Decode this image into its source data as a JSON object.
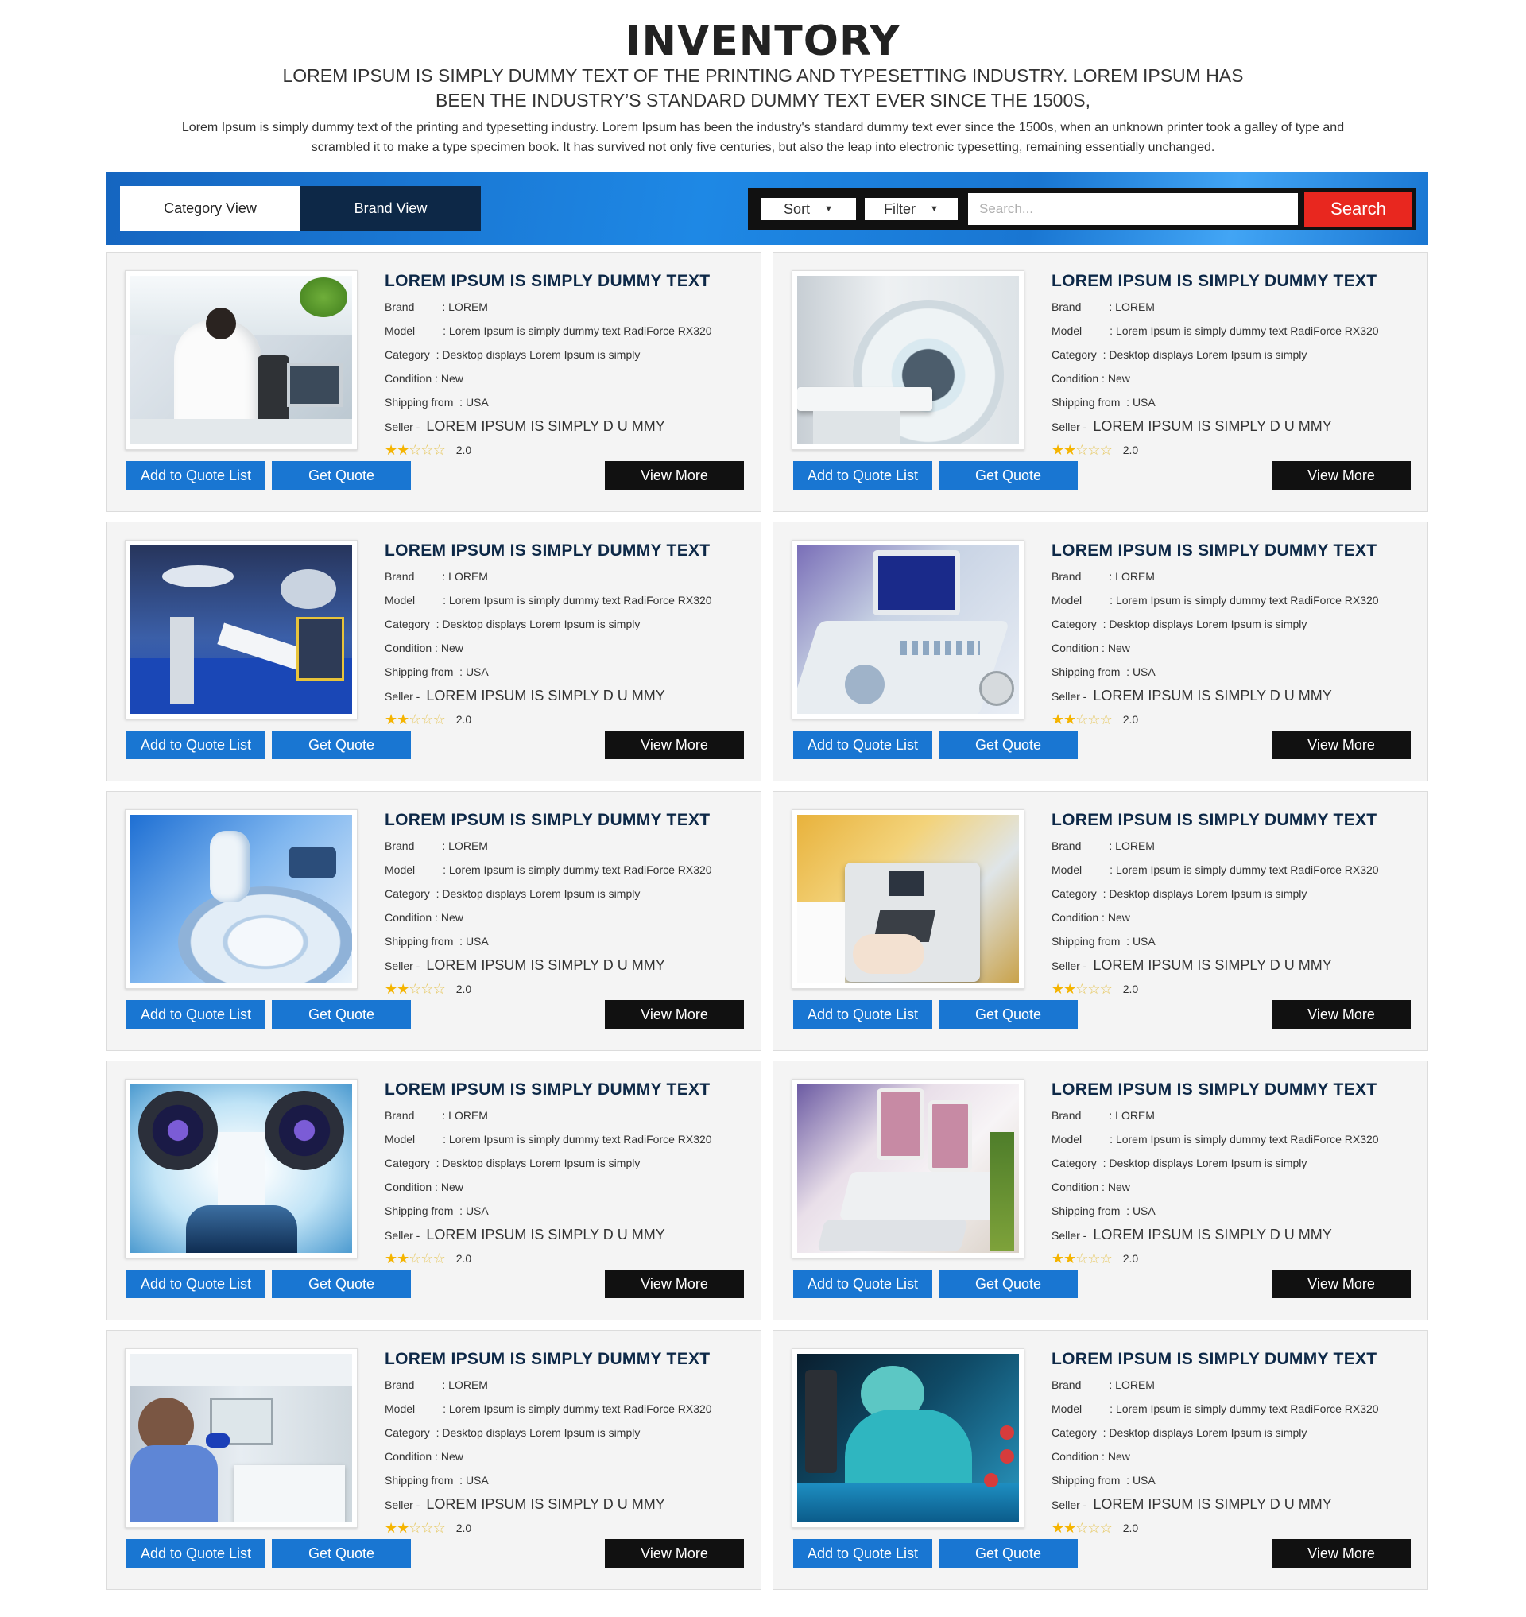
{
  "page": {
    "title": "INVENTORY",
    "subtitle": "LOREM IPSUM IS SIMPLY DUMMY TEXT OF THE PRINTING AND TYPESETTING INDUSTRY. LOREM IPSUM HAS BEEN THE INDUSTRY’S STANDARD DUMMY TEXT EVER SINCE THE 1500S,",
    "intro": "Lorem Ipsum is simply dummy text of the printing and typesetting industry. Lorem Ipsum has been the industry's standard dummy text ever since the 1500s, when an unknown printer took a galley of type and scrambled it to make a type specimen book. It has survived not only five centuries, but also the leap into electronic typesetting, remaining essentially unchanged."
  },
  "toolbar": {
    "tab_category": "Category View",
    "tab_brand": "Brand View",
    "sort_label": "Sort",
    "filter_label": "Filter",
    "search_placeholder": "Search...",
    "search_button": "Search"
  },
  "labels": {
    "brand": "Brand         : ",
    "model": "Model         : ",
    "category": "Category  : ",
    "condition": "Condition : ",
    "shipping": "Shipping from  : ",
    "seller": "Seller - ",
    "add_to_quote": "Add to Quote List",
    "get_quote": "Get Quote",
    "view_more": "View More"
  },
  "colors": {
    "accent_blue": "#1976d2",
    "navy": "#0d2847",
    "search_red": "#e8271f",
    "star": "#f5b400"
  },
  "products": [
    {
      "title": "LOREM IPSUM IS SIMPLY DUMMY TEXT",
      "brand": "LOREM",
      "model": "Lorem Ipsum is simply dummy text RadiForce RX320",
      "category": "Desktop displays Lorem Ipsum is simply",
      "condition": "New",
      "shipping": "USA",
      "seller": "LOREM IPSUM IS SIMPLY D U MMY",
      "rating": "2.0",
      "stars": 2,
      "image": "lab-microscope-scientist"
    },
    {
      "title": "LOREM IPSUM IS SIMPLY DUMMY TEXT",
      "brand": "LOREM",
      "model": "Lorem Ipsum is simply dummy text RadiForce RX320",
      "category": "Desktop displays Lorem Ipsum is simply",
      "condition": "New",
      "shipping": "USA",
      "seller": "LOREM IPSUM IS SIMPLY D U MMY",
      "rating": "2.0",
      "stars": 2,
      "image": "mri-scanner"
    },
    {
      "title": "LOREM IPSUM IS SIMPLY DUMMY TEXT",
      "brand": "LOREM",
      "model": "Lorem Ipsum is simply dummy text RadiForce RX320",
      "category": "Desktop displays Lorem Ipsum is simply",
      "condition": "New",
      "shipping": "USA",
      "seller": "LOREM IPSUM IS SIMPLY D U MMY",
      "rating": "2.0",
      "stars": 2,
      "image": "operating-room"
    },
    {
      "title": "LOREM IPSUM IS SIMPLY DUMMY TEXT",
      "brand": "LOREM",
      "model": "Lorem Ipsum is simply dummy text RadiForce RX320",
      "category": "Desktop displays Lorem Ipsum is simply",
      "condition": "New",
      "shipping": "USA",
      "seller": "LOREM IPSUM IS SIMPLY D U MMY",
      "rating": "2.0",
      "stars": 2,
      "image": "ultrasound-console"
    },
    {
      "title": "LOREM IPSUM IS SIMPLY DUMMY TEXT",
      "brand": "LOREM",
      "model": "Lorem Ipsum is simply dummy text RadiForce RX320",
      "category": "Desktop displays Lorem Ipsum is simply",
      "condition": "New",
      "shipping": "USA",
      "seller": "LOREM IPSUM IS SIMPLY D U MMY",
      "rating": "2.0",
      "stars": 2,
      "image": "centrifuge"
    },
    {
      "title": "LOREM IPSUM IS SIMPLY DUMMY TEXT",
      "brand": "LOREM",
      "model": "Lorem Ipsum is simply dummy text RadiForce RX320",
      "category": "Desktop displays Lorem Ipsum is simply",
      "condition": "New",
      "shipping": "USA",
      "seller": "LOREM IPSUM IS SIMPLY D U MMY",
      "rating": "2.0",
      "stars": 2,
      "image": "lab-analyzer-hands"
    },
    {
      "title": "LOREM IPSUM IS SIMPLY DUMMY TEXT",
      "brand": "LOREM",
      "model": "Lorem Ipsum is simply dummy text RadiForce RX320",
      "category": "Desktop displays Lorem Ipsum is simply",
      "condition": "New",
      "shipping": "USA",
      "seller": "LOREM IPSUM IS SIMPLY D U MMY",
      "rating": "2.0",
      "stars": 2,
      "image": "microscope-eyepieces"
    },
    {
      "title": "LOREM IPSUM IS SIMPLY DUMMY TEXT",
      "brand": "LOREM",
      "model": "Lorem Ipsum is simply dummy text RadiForce RX320",
      "category": "Desktop displays Lorem Ipsum is simply",
      "condition": "New",
      "shipping": "USA",
      "seller": "LOREM IPSUM IS SIMPLY D U MMY",
      "rating": "2.0",
      "stars": 2,
      "image": "ultrasound-machines"
    },
    {
      "title": "LOREM IPSUM IS SIMPLY DUMMY TEXT",
      "brand": "LOREM",
      "model": "Lorem Ipsum is simply dummy text RadiForce RX320",
      "category": "Desktop displays Lorem Ipsum is simply",
      "condition": "New",
      "shipping": "USA",
      "seller": "LOREM IPSUM IS SIMPLY D U MMY",
      "rating": "2.0",
      "stars": 2,
      "image": "technician-lab-hood"
    },
    {
      "title": "LOREM IPSUM IS SIMPLY DUMMY TEXT",
      "brand": "LOREM",
      "model": "Lorem Ipsum is simply dummy text RadiForce RX320",
      "category": "Desktop displays Lorem Ipsum is simply",
      "condition": "New",
      "shipping": "USA",
      "seller": "LOREM IPSUM IS SIMPLY D U MMY",
      "rating": "2.0",
      "stars": 2,
      "image": "scientist-test-tube"
    }
  ]
}
